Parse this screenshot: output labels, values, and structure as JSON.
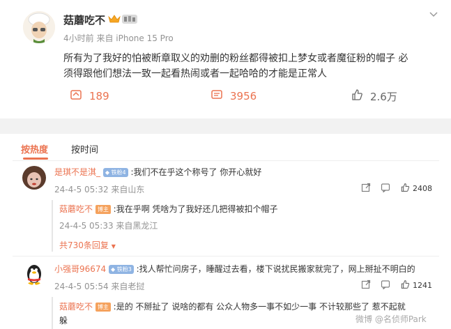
{
  "post": {
    "author": "菇蘑吃不",
    "time_source": "4小时前  来自 iPhone 15 Pro",
    "text_line1": "所有为了我好的怕被断章取义的劝删的粉丝都得被扣上梦女或者魔征粉的帽子 必",
    "text_line2": "须得跟他们想法一致一起看热闹或者一起哈哈的才能是正常人",
    "repost_count": "189",
    "comment_count": "3956",
    "like_count": "2.6万"
  },
  "sort_tabs": [
    {
      "label": "按热度",
      "active": true
    },
    {
      "label": "按时间",
      "active": false
    }
  ],
  "comments": [
    {
      "user": "是琪不是淇_",
      "level": "铁粉4",
      "text": ":我们不在乎这个称号了 你开心就好",
      "meta": "24-4-5 05:32 来自山东",
      "likes": "2408",
      "reply": {
        "user": "菇蘑吃不",
        "badge": "博主",
        "text": ":我在乎啊 凭啥为了我好还几把得被扣个帽子",
        "meta": "24-4-5 05:33 来自黑龙江"
      },
      "more_replies": "共730条回复"
    },
    {
      "user": "小强哥96674",
      "level": "铁粉3",
      "text": ":找人帮忙问房子，睡醒过去看，楼下说扰民搬家就完了，网上掰扯不明白的",
      "meta": "24-4-5 05:54 来自老挝",
      "likes": "1241",
      "reply": {
        "user": "菇蘑吃不",
        "badge": "博主",
        "text_line1": ":是的 不掰扯了 说啥的都有 公众人物多一事不如少一事 不计较那些了 惹不起就",
        "text_line2": "躲"
      }
    }
  ],
  "watermark": "微博 @名侦师Park",
  "colors": {
    "accent": "#eb7350",
    "muted": "#939393",
    "divider": "#f2f2f2"
  }
}
